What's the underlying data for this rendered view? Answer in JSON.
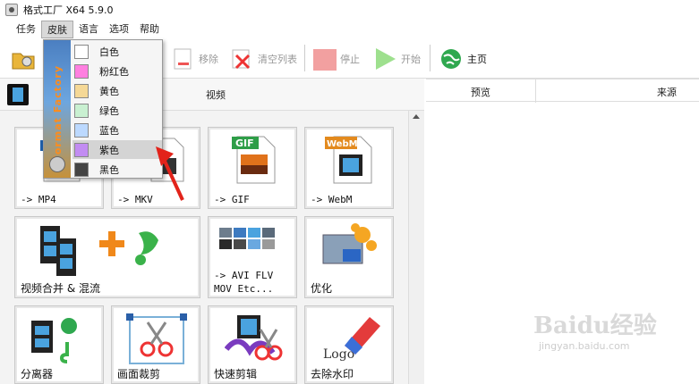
{
  "window": {
    "title": "格式工厂 X64 5.9.0"
  },
  "menu": [
    "任务",
    "皮肤",
    "语言",
    "选项",
    "帮助"
  ],
  "toolbar": {
    "remove": "移除",
    "clear_list": "清空列表",
    "stop": "停止",
    "start": "开始",
    "home": "主页"
  },
  "category": {
    "label": "视频"
  },
  "right": {
    "col_preview": "预览",
    "col_source": "来源"
  },
  "skin_menu": {
    "side_text": "Format Factory",
    "items": [
      {
        "label": "白色",
        "color": "#ffffff"
      },
      {
        "label": "粉红色",
        "color": "#ff7fe0"
      },
      {
        "label": "黄色",
        "color": "#f5d896"
      },
      {
        "label": "绿色",
        "color": "#c9f0d1"
      },
      {
        "label": "蓝色",
        "color": "#bcd9ff"
      },
      {
        "label": "紫色",
        "color": "#c28cf2"
      },
      {
        "label": "黑色",
        "color": "#444444"
      }
    ],
    "highlighted": "紫色"
  },
  "tiles": [
    {
      "label": "-> MP4",
      "icon": "mp4-icon"
    },
    {
      "label": "-> MKV",
      "icon": "mkv-icon"
    },
    {
      "label": "-> GIF",
      "icon": "gif-icon",
      "badge": "GIF"
    },
    {
      "label": "-> WebM",
      "icon": "webm-icon",
      "badge": "WebM"
    },
    {
      "label": "视频合并 & 混流",
      "icon": "merge-icon"
    },
    {
      "label": "-> AVI FLV\nMOV Etc...",
      "icon": "formats-icon"
    },
    {
      "label": "优化",
      "icon": "optimize-icon"
    },
    {
      "label": "分离器",
      "icon": "splitter-icon"
    },
    {
      "label": "画面裁剪",
      "icon": "crop-icon"
    },
    {
      "label": "快速剪辑",
      "icon": "quick-cut-icon"
    },
    {
      "label": "去除水印",
      "icon": "remove-watermark-icon",
      "badge": "Logo"
    }
  ],
  "watermark": {
    "text": "Baidu经验",
    "url": "jingyan.baidu.com"
  }
}
